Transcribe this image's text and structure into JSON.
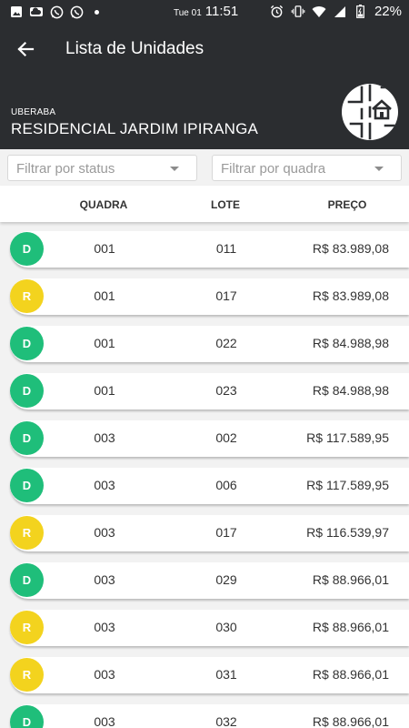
{
  "status_bar": {
    "day": "Tue 01",
    "time": "11:51",
    "battery": "22%",
    "left_icons": [
      "image-icon",
      "cloud-icon",
      "whatsapp-icon",
      "whatsapp-icon"
    ],
    "right_icons": [
      "alarm-icon",
      "vibrate-icon",
      "wifi-icon",
      "signal-icon",
      "battery-icon"
    ]
  },
  "header": {
    "title": "Lista de Unidades",
    "city": "UBERABA",
    "venture": "RESIDENCIAL JARDIM IPIRANGA",
    "back_icon": "arrow-back-icon"
  },
  "filters": {
    "status_placeholder": "Filtrar por status",
    "quadra_placeholder": "Filtrar por quadra"
  },
  "columns": {
    "quadra": "QUADRA",
    "lote": "LOTE",
    "preco": "PREÇO"
  },
  "status_colors": {
    "D": "#1fbe7a",
    "R": "#f3d31e"
  },
  "units": [
    {
      "status": "D",
      "quadra": "001",
      "lote": "011",
      "preco": "R$ 83.989,08"
    },
    {
      "status": "R",
      "quadra": "001",
      "lote": "017",
      "preco": "R$ 83.989,08"
    },
    {
      "status": "D",
      "quadra": "001",
      "lote": "022",
      "preco": "R$ 84.988,98"
    },
    {
      "status": "D",
      "quadra": "001",
      "lote": "023",
      "preco": "R$ 84.988,98"
    },
    {
      "status": "D",
      "quadra": "003",
      "lote": "002",
      "preco": "R$ 117.589,95"
    },
    {
      "status": "D",
      "quadra": "003",
      "lote": "006",
      "preco": "R$ 117.589,95"
    },
    {
      "status": "R",
      "quadra": "003",
      "lote": "017",
      "preco": "R$ 116.539,97"
    },
    {
      "status": "D",
      "quadra": "003",
      "lote": "029",
      "preco": "R$ 88.966,01"
    },
    {
      "status": "R",
      "quadra": "003",
      "lote": "030",
      "preco": "R$ 88.966,01"
    },
    {
      "status": "R",
      "quadra": "003",
      "lote": "031",
      "preco": "R$ 88.966,01"
    },
    {
      "status": "D",
      "quadra": "003",
      "lote": "032",
      "preco": "R$ 88.966,01"
    }
  ]
}
